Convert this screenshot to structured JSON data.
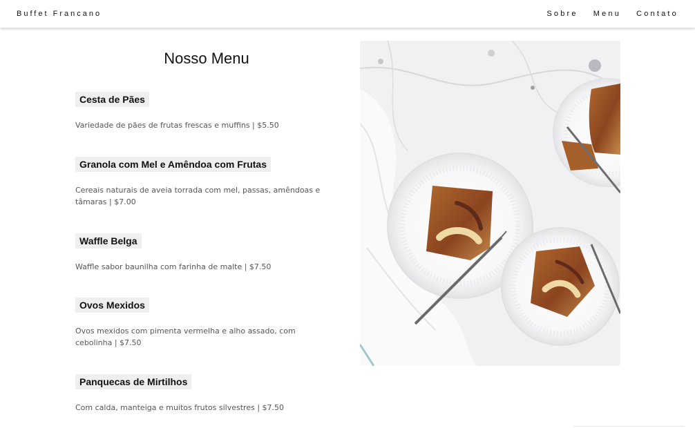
{
  "nav": {
    "brand": "Buffet Francano",
    "links": [
      "Sobre",
      "Menu",
      "Contato"
    ]
  },
  "menu": {
    "title": "Nosso Menu",
    "items": [
      {
        "name": "Cesta de Pães",
        "description": "Variedade de pães de frutas frescas e muffins | $5.50"
      },
      {
        "name": "Granola com Mel e Amêndoa com Frutas",
        "description": "Cereais naturais de aveia torrada com mel, passas, amêndoas e tâmaras | $7.00"
      },
      {
        "name": "Waffle Belga",
        "description": "Waffle sabor baunilha com farinha de malte | $7.50"
      },
      {
        "name": "Ovos Mexidos",
        "description": "Ovos mexidos com pimenta vermelha e alho assado, com cebolinha | $7.50"
      },
      {
        "name": "Panquecas de Mirtilhos",
        "description": "Com calda, manteiga e muitos frutos silvestres | $7.50"
      }
    ]
  },
  "colors": {
    "nav_bg": "#ffffff",
    "item_name_bg": "#efefef",
    "description_text": "#555555",
    "marble": "#f1f1f3"
  },
  "image": {
    "icon": "tart-on-plates-photo"
  }
}
